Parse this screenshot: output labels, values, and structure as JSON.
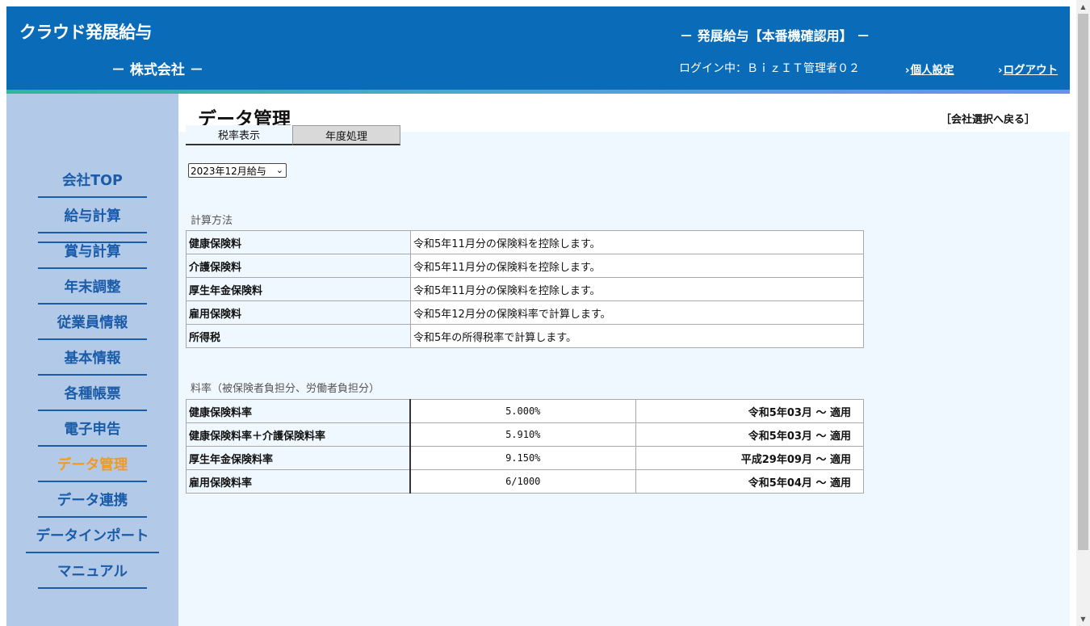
{
  "header": {
    "brand": "クラウド発展給与",
    "company": "－ 株式会社 －",
    "system_title": "－ 発展給与【本番機確認用】 －",
    "login_text": "ログイン中：ＢｉｚＩＴ管理者０２",
    "personal_settings": "個人設定",
    "logout": "ログアウト",
    "chevron": "›"
  },
  "sidebar": {
    "items": [
      {
        "label": "会社TOP"
      },
      {
        "label": "給与計算"
      },
      {
        "label": "賞与計算"
      },
      {
        "label": "年末調整"
      },
      {
        "label": "従業員情報"
      },
      {
        "label": "基本情報"
      },
      {
        "label": "各種帳票"
      },
      {
        "label": "電子申告"
      },
      {
        "label": "データ管理",
        "active": true
      },
      {
        "label": "データ連携"
      },
      {
        "label": "データインポート"
      },
      {
        "label": "マニュアル"
      }
    ]
  },
  "main": {
    "page_title": "データ管理",
    "back_link": "［会社選択へ戻る］",
    "tabs": [
      {
        "label": "税率表示",
        "selected": true
      },
      {
        "label": "年度処理",
        "selected": false
      }
    ],
    "period_select": {
      "value": "2023年12月給与"
    },
    "calc_section": {
      "title": "計算方法",
      "rows": [
        {
          "label": "健康保険料",
          "value": "令和5年11月分の保険料を控除します。"
        },
        {
          "label": "介護保険料",
          "value": "令和5年11月分の保険料を控除します。"
        },
        {
          "label": "厚生年金保険料",
          "value": "令和5年11月分の保険料を控除します。"
        },
        {
          "label": "雇用保険料",
          "value": "令和5年12月分の保険料率で計算します。"
        },
        {
          "label": "所得税",
          "value": "令和5年の所得税率で計算します。"
        }
      ]
    },
    "rate_section": {
      "title": "料率（被保険者負担分、労働者負担分）",
      "rows": [
        {
          "label": "健康保険料率",
          "rate": "5.000%",
          "period": "令和5年03月 ～ 適用"
        },
        {
          "label": "健康保険料率＋介護保険料率",
          "rate": "5.910%",
          "period": "令和5年03月 ～ 適用"
        },
        {
          "label": "厚生年金保険料率",
          "rate": "9.150%",
          "period": "平成29年09月 ～ 適用"
        },
        {
          "label": "雇用保険料率",
          "rate": "6/1000",
          "period": "令和5年04月 ～ 適用"
        }
      ]
    }
  },
  "colors": {
    "header_bg": "#0a6cb8",
    "sidebar_bg": "#b3c9e8",
    "nav_text": "#1a5ca8",
    "nav_active": "#f39a1e",
    "content_bg": "#f0f8ff"
  }
}
